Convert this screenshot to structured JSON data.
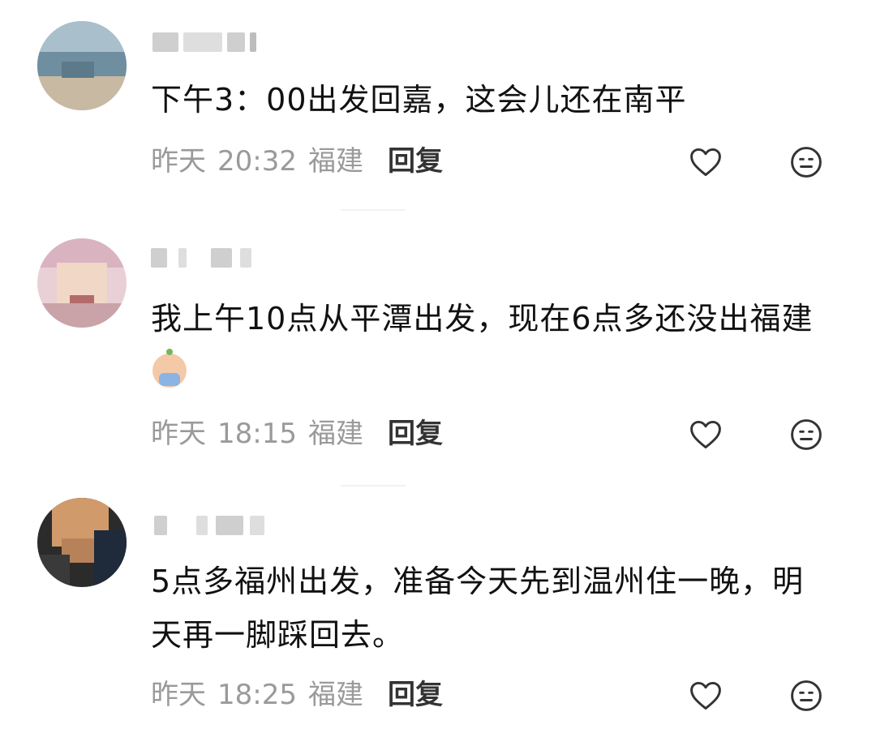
{
  "comments": [
    {
      "text": "下午3：00出发回嘉，这会儿还在南平",
      "date": "昨天",
      "time": "20:32",
      "location": "福建",
      "reply_label": "回复",
      "like_icon": "heart-outline",
      "more_icon": "face-emoji-outline"
    },
    {
      "text": "我上午10点从平潭出发，现在6点多还没出福建",
      "date": "昨天",
      "time": "18:15",
      "location": "福建",
      "reply_label": "回复",
      "trailing_emoji": "crying-emoji",
      "like_icon": "heart-outline",
      "more_icon": "face-emoji-outline"
    },
    {
      "text": "5点多福州出发，准备今天先到温州住一晚，明天再一脚踩回去。",
      "date": "昨天",
      "time": "18:25",
      "location": "福建",
      "reply_label": "回复",
      "like_icon": "heart-outline",
      "more_icon": "face-emoji-outline"
    }
  ]
}
